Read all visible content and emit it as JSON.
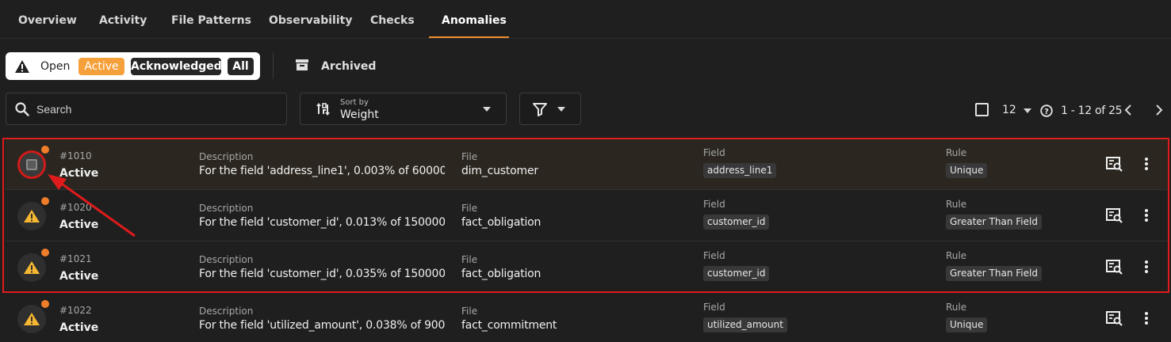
{
  "tabs": [
    {
      "label": "Overview"
    },
    {
      "label": "Activity"
    },
    {
      "label": "File Patterns"
    },
    {
      "label": "Observability"
    },
    {
      "label": "Checks"
    },
    {
      "label": "Anomalies"
    }
  ],
  "active_tab": "Anomalies",
  "status_filter": {
    "open_label": "Open",
    "active_label": "Active",
    "acknowledged_label": "Acknowledged",
    "all_label": "All",
    "archived_label": "Archived"
  },
  "toolbar": {
    "search_placeholder": "Search",
    "sort_small_label": "Sort by",
    "sort_value": "Weight",
    "page_size": "12",
    "range_label": "1 - 12 of 25"
  },
  "column_labels": {
    "description": "Description",
    "file": "File",
    "field": "Field",
    "rule": "Rule"
  },
  "rows": [
    {
      "id": "#1010",
      "status": "Active",
      "description": "For the field 'address_line1', 0.003% of 60000 ...",
      "file": "dim_customer",
      "field": "address_line1",
      "rule": "Unique"
    },
    {
      "id": "#1020",
      "status": "Active",
      "description": "For the field 'customer_id', 0.013% of 150000 r...",
      "file": "fact_obligation",
      "field": "customer_id",
      "rule": "Greater Than Field"
    },
    {
      "id": "#1021",
      "status": "Active",
      "description": "For the field 'customer_id', 0.035% of 150000 r...",
      "file": "fact_obligation",
      "field": "customer_id",
      "rule": "Greater Than Field"
    },
    {
      "id": "#1022",
      "status": "Active",
      "description": "For the field 'utilized_amount', 0.038% of 900...",
      "file": "fact_commitment",
      "field": "utilized_amount",
      "rule": "Unique"
    }
  ],
  "colors": {
    "accent": "#f0902e",
    "warning": "#f5b731",
    "badge_dot": "#f07d2a",
    "highlight": "#e01b1b"
  },
  "icons": [
    "warning-icon",
    "archive-icon",
    "search-icon",
    "sort-icon",
    "filter-icon",
    "help-icon",
    "chevron-left-icon",
    "chevron-right-icon",
    "inspect-icon",
    "more-icon"
  ]
}
